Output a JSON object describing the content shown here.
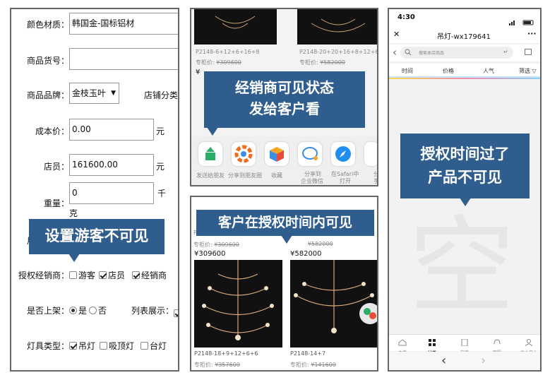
{
  "panel1": {
    "color_material": {
      "label": "颜色材质：",
      "value": "韩国金-国标铝材"
    },
    "item_no": {
      "label": "商品货号："
    },
    "brand": {
      "label": "商品品牌：",
      "value": "金枝玉叶",
      "category_label": "店铺分类"
    },
    "cost": {
      "label": "成本价：",
      "value": "0.00",
      "unit": "元"
    },
    "store_price": {
      "label": "店员：",
      "value": "161600.00",
      "unit": "元"
    },
    "weight": {
      "label": "重量：",
      "value": "0",
      "unit_top": "千",
      "unit_bottom": "克"
    },
    "hidden_label": "用",
    "auth_dealer": {
      "label": "授权经销商：",
      "options": [
        {
          "label": "游客",
          "checked": false
        },
        {
          "label": "店员",
          "checked": true
        },
        {
          "label": "经销商",
          "checked": true
        }
      ]
    },
    "on_shelf": {
      "label": "是否上架：",
      "yes": "是",
      "no": "否",
      "list_label": "列表展示："
    },
    "lamp_type": {
      "label": "灯具类型：",
      "options": [
        {
          "label": "吊灯",
          "checked": true
        },
        {
          "label": "吸顶灯",
          "checked": false
        },
        {
          "label": "台灯",
          "checked": false
        }
      ]
    },
    "callout": "设置游客不可见"
  },
  "panel2": {
    "products": [
      {
        "code": "P2148-6+12+6+16+8",
        "price_label": "专柜价:",
        "price": "¥309600",
        "sale": "¥"
      },
      {
        "code": "P2148-20+20+16+8+12+6+6",
        "price_label": "专柜价:",
        "price": "¥582000"
      }
    ],
    "callout_line1": "经销商可见状态",
    "callout_line2": "发给客户看",
    "share_items": [
      {
        "label1": "发送给朋友",
        "label2": ""
      },
      {
        "label1": "分享到朋友圈",
        "label2": ""
      },
      {
        "label1": "收藏",
        "label2": ""
      },
      {
        "label1": "分享到",
        "label2": "企业微信"
      },
      {
        "label1": "在Safari中",
        "label2": "打开"
      },
      {
        "label1": "分",
        "label2": "手"
      }
    ],
    "icon_colors": {
      "send": "#2aae67",
      "wheel": "#f26b1d",
      "fav": "#f5a623",
      "wecom": "#3a8ee6",
      "safari": "#1f8ef1"
    }
  },
  "panel3": {
    "callout": "客户在授权时间内可见",
    "top_left_price_label": "专柜价:",
    "top_left_strike": "¥309600",
    "top_right_strike": "¥582000",
    "left_price": "¥309600",
    "right_price": "¥582000",
    "items": [
      {
        "code": "P2148-18+9+12+6+6",
        "price_label": "专柜价:",
        "price": "¥357600"
      },
      {
        "code": "P2148-14+7",
        "price_label": "专柜价:",
        "price": "¥141600"
      }
    ],
    "left_code_prefix": "P"
  },
  "panel4": {
    "time": "4:30",
    "title": "吊灯-wx179641",
    "close": "✕",
    "more": "···",
    "back": "‹",
    "search_placeholder": "搜索本店商品",
    "tabs": [
      "时间",
      "价格",
      "人气"
    ],
    "filter": "筛选",
    "callout_line1": "授权时间过了",
    "callout_line2": "产品不可见",
    "empty_char": "空",
    "nav": [
      "主页",
      "分类",
      "文章",
      "客服",
      "个人中心"
    ],
    "nav_back": "‹",
    "nav_forward": "›"
  }
}
